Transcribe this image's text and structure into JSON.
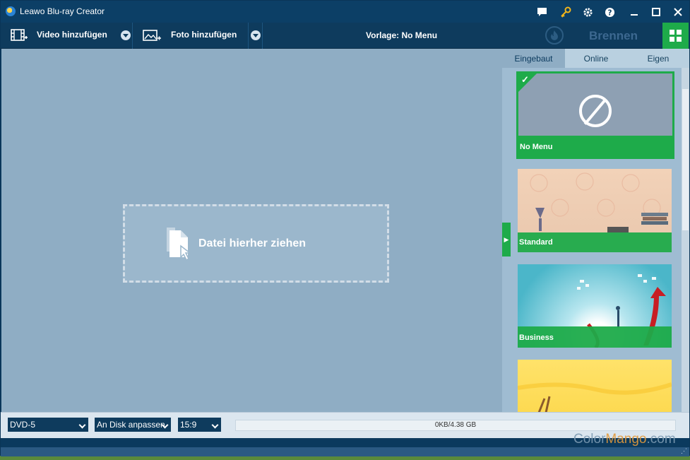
{
  "window": {
    "title": "Leawo Blu-ray Creator"
  },
  "toolbar": {
    "add_video": "Video hinzufügen",
    "add_photo": "Foto hinzufügen",
    "template": "Vorlage: No Menu",
    "burn": "Brennen"
  },
  "dropzone": {
    "text": "Datei hierher ziehen"
  },
  "panel": {
    "tabs": [
      {
        "label": "Eingebaut",
        "active": true
      },
      {
        "label": "Online",
        "active": false
      },
      {
        "label": "Eigen",
        "active": false
      }
    ],
    "templates": [
      {
        "label": "No Menu",
        "selected": true
      },
      {
        "label": "Standard"
      },
      {
        "label": "Business"
      },
      {
        "label": ""
      }
    ]
  },
  "bottom": {
    "disc_type": "DVD-5",
    "fit_mode": "An Disk anpassen",
    "aspect": "15:9",
    "usage": "0KB/4.38 GB"
  },
  "watermark": {
    "part1": "Color",
    "part2": "Mango",
    "part3": ".com"
  },
  "colors": {
    "accent_green": "#1eab4a",
    "navy": "#0e3b5d",
    "panel_bg": "#8fadc4"
  }
}
